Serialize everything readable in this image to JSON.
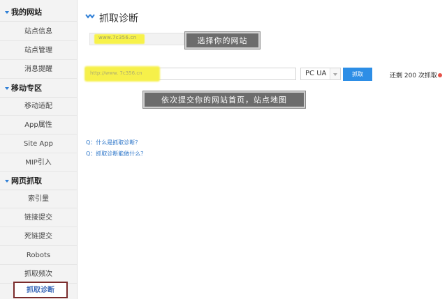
{
  "sidebar": {
    "sections": [
      {
        "label": "我的网站",
        "items": [
          "站点信息",
          "站点管理",
          "消息提醒"
        ]
      },
      {
        "label": "移动专区",
        "items": [
          "移动适配",
          "App属性",
          "Site App",
          "MIP引入"
        ]
      },
      {
        "label": "网页抓取",
        "items": [
          "索引量",
          "链接提交",
          "死链提交",
          "Robots",
          "抓取频次",
          "抓取诊断"
        ]
      }
    ],
    "active_item": "抓取诊断"
  },
  "main": {
    "title": "抓取诊断",
    "site_select": {
      "value": "www.7c356.cn"
    },
    "callouts": {
      "select_site": "选择你的网站",
      "submit_hint": "依次提交你的网站首页，站点地图"
    },
    "url_input": {
      "value": "http://www. 7c356.cn"
    },
    "ua_select": {
      "value": "PC UA"
    },
    "fetch_button": "抓取",
    "remaining": "还剩 200 次抓取",
    "faq": [
      "Q：什么是抓取诊断？",
      "Q：抓取诊断能做什么？"
    ]
  },
  "colors": {
    "accent": "#2d8ee6",
    "highlight": "#f6f04a",
    "active_border": "#7a2b2b",
    "callout_bg": "#6c6c6c"
  },
  "icons": {
    "title": "double-chevron-icon",
    "section": "triangle-down-icon",
    "help": "help-icon"
  }
}
